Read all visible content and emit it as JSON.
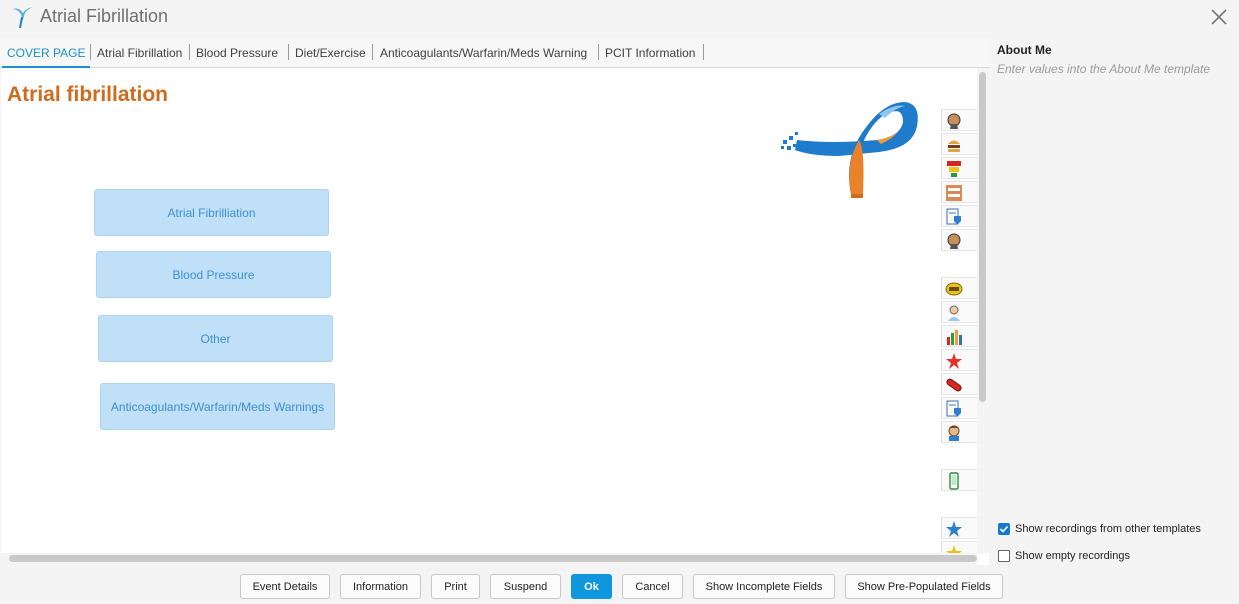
{
  "window": {
    "title": "Atrial Fibrillation"
  },
  "tabs": [
    {
      "label": "COVER PAGE",
      "active": true
    },
    {
      "label": "Atrial Fibrillation"
    },
    {
      "label": "Blood Pressure"
    },
    {
      "label": "Diet/Exercise"
    },
    {
      "label": "Anticoagulants/Warfarin/Meds Warning"
    },
    {
      "label": "PCIT Information"
    }
  ],
  "main": {
    "heading": "Atrial fibrillation",
    "heading_color": "#cf6b1d",
    "nav_buttons": [
      {
        "label": "Atrial Fibrilliation"
      },
      {
        "label": "Blood Pressure"
      },
      {
        "label": "Other"
      },
      {
        "label": "Anticoagulants/Warfarin/Meds Warnings"
      }
    ],
    "icon_strip": [
      "patient-profile-icon",
      "food-icon",
      "traffic-light-icon",
      "at-risk-icon",
      "document-shield-icon",
      "patient-profile-icon",
      "gms-badge-icon",
      "doctor-icon",
      "bar-chart-icon",
      "red-star-icon",
      "pill-icon",
      "document-shield-icon",
      "person-icon",
      "mobile-phone-icon",
      "blue-star-icon",
      "gold-star-icon"
    ]
  },
  "sidebar": {
    "title": "About Me",
    "subtitle": "Enter values into the About Me template",
    "options": [
      {
        "label": "Show recordings from other templates",
        "checked": true
      },
      {
        "label": "Show empty recordings",
        "checked": false
      }
    ]
  },
  "footer": {
    "buttons": [
      {
        "label": "Event Details"
      },
      {
        "label": "Information"
      },
      {
        "label": "Print"
      },
      {
        "label": "Suspend"
      },
      {
        "label": "Ok",
        "primary": true
      },
      {
        "label": "Cancel"
      },
      {
        "label": "Show Incomplete Fields"
      },
      {
        "label": "Show Pre-Populated Fields"
      }
    ]
  },
  "colors": {
    "accent": "#1096dd",
    "tab_active": "#1c8fd0",
    "nav_button_bg": "#bfe0f6",
    "nav_button_text": "#3f8fcf"
  }
}
